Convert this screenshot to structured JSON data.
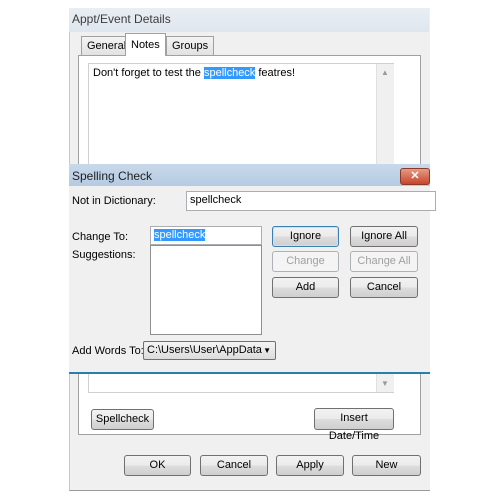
{
  "appt_window": {
    "title": "Appt/Event Details",
    "tabs": [
      {
        "label": "General",
        "active": false
      },
      {
        "label": "Notes",
        "active": true
      },
      {
        "label": "Groups",
        "active": false
      }
    ],
    "notes": {
      "before": "Don't forget to test the ",
      "highlighted": "spellcheck",
      "after": " featres!"
    },
    "spellcheck_button": "Spellcheck",
    "insert_datetime_button": "Insert Date/Time",
    "footer_buttons": {
      "ok": "OK",
      "cancel": "Cancel",
      "apply": "Apply",
      "new": "New"
    },
    "scroll_up_icon": "▲",
    "scroll_down_icon": "▼"
  },
  "spelling_dialog": {
    "title": "Spelling Check",
    "close_icon": "✕",
    "not_in_dictionary_label": "Not in Dictionary:",
    "not_in_dictionary_value": "spellcheck",
    "change_to_label": "Change To:",
    "change_to_value": "spellcheck",
    "suggestions_label": "Suggestions:",
    "suggestions": [],
    "buttons": {
      "ignore": "Ignore",
      "ignore_all": "Ignore All",
      "change": "Change",
      "change_all": "Change All",
      "add": "Add",
      "cancel": "Cancel"
    },
    "add_words_to_label": "Add Words To:",
    "add_words_to_value": "C:\\Users\\User\\AppData",
    "dropdown_icon": "▼"
  }
}
